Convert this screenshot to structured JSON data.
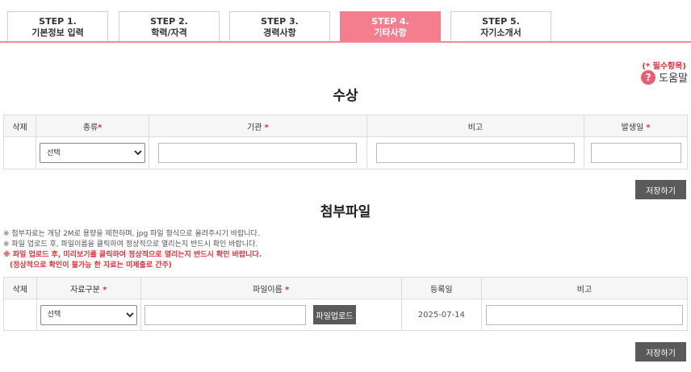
{
  "steps": [
    {
      "num": "STEP 1.",
      "label": "기본정보 입력",
      "active": false
    },
    {
      "num": "STEP 2.",
      "label": "학력/자격",
      "active": false
    },
    {
      "num": "STEP 3.",
      "label": "경력사항",
      "active": false
    },
    {
      "num": "STEP 4.",
      "label": "기타사항",
      "active": true
    },
    {
      "num": "STEP 5.",
      "label": "자기소개서",
      "active": false
    }
  ],
  "required_note": "(* 필수항목)",
  "help": {
    "icon": "?",
    "label": "도움말"
  },
  "awards": {
    "title": "수상",
    "headers": {
      "delete": "삭제",
      "type": "종류",
      "org": "기관",
      "note": "비고",
      "date": "발생일"
    },
    "required_mark": "*",
    "type_select": "선택",
    "save_label": "저장하기"
  },
  "attachments": {
    "title": "첨부파일",
    "notes": [
      "※ 첨부자료는 개당 2M로 용량을 제한하며, jpg 파일 형식으로 올려주시기 바랍니다.",
      "※ 파일 업로드 후, 파일이름을 클릭하여 정상적으로 열리는지 반드시 확인 바랍니다."
    ],
    "warning_line1": "※ 파일 업로드 후, 미리보기를 클릭하여 정상적으로 열리는지 반드시 확인 바랍니다.",
    "warning_line2": "(정상적으로 확인이 불가능 한 자료는 미제출로 간주)",
    "headers": {
      "delete": "삭제",
      "category": "자료구분",
      "filename": "파일이름",
      "regdate": "등록일",
      "note": "비고"
    },
    "required_mark": "*",
    "category_select": "선택",
    "upload_label": "파일업로드",
    "row_regdate": "2025-07-14",
    "save_label": "저장하기"
  },
  "colors": {
    "active_step": "#f47d8e",
    "required": "#e0303a",
    "button": "#5a5a5a"
  }
}
